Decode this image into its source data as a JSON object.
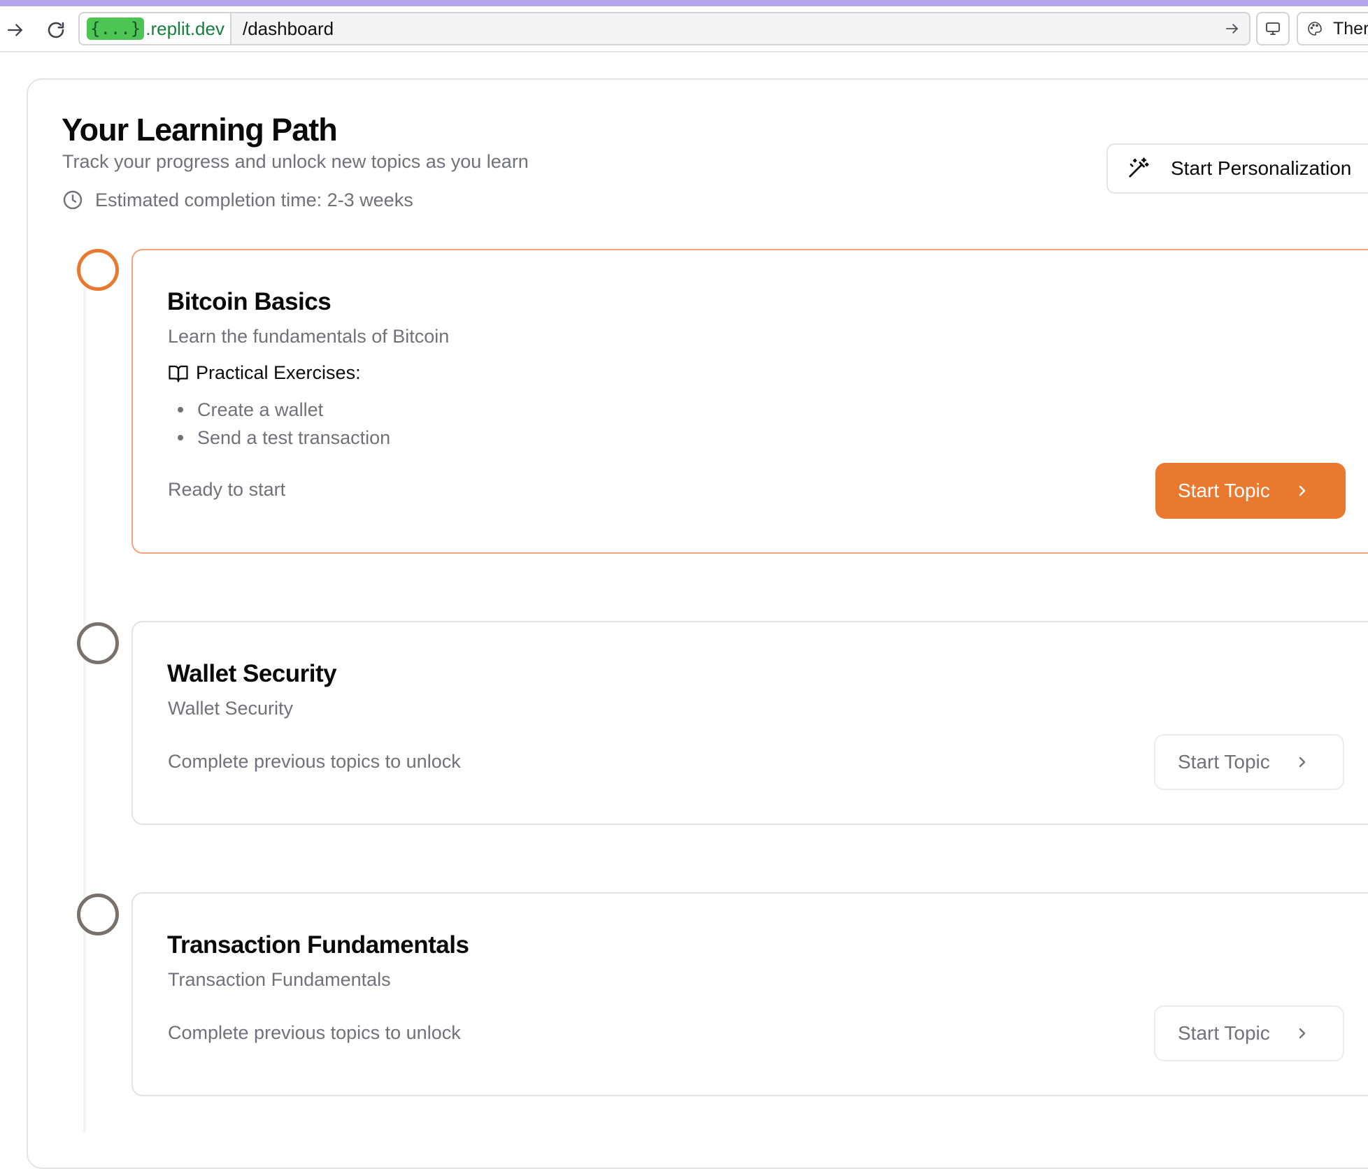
{
  "browser": {
    "url_badge": "{...}",
    "url_domain": ".replit.dev",
    "url_path": "/dashboard",
    "theme_label": "Ther"
  },
  "header": {
    "title": "Your Learning Path",
    "subtitle": "Track your progress and unlock new topics as you learn",
    "estimated_time": "Estimated completion time: 2-3 weeks",
    "personalize_label": "Start Personalization"
  },
  "topics": [
    {
      "title": "Bitcoin Basics",
      "description": "Learn the fundamentals of Bitcoin",
      "exercises_heading": "Practical Exercises:",
      "exercises": [
        "Create a wallet",
        "Send a test transaction"
      ],
      "status": "Ready to start",
      "button_label": "Start Topic",
      "state": "active"
    },
    {
      "title": "Wallet Security",
      "description": "Wallet Security",
      "status": "Complete previous topics to unlock",
      "button_label": "Start Topic",
      "state": "locked"
    },
    {
      "title": "Transaction Fundamentals",
      "description": "Transaction Fundamentals",
      "status": "Complete previous topics to unlock",
      "button_label": "Start Topic",
      "state": "locked"
    }
  ],
  "colors": {
    "accent": "#e8792f",
    "active_border": "#f5a37a",
    "muted_text": "#71717a",
    "browser_accent": "#b3a6ef"
  },
  "icons": {
    "back": "arrow-right-icon",
    "reload": "reload-icon",
    "go": "arrow-right-icon",
    "devices": "monitor-icon",
    "theme": "palette-icon",
    "clock": "clock-icon",
    "wand": "magic-wand-icon",
    "book": "book-open-icon",
    "chevron": "chevron-right-icon"
  }
}
